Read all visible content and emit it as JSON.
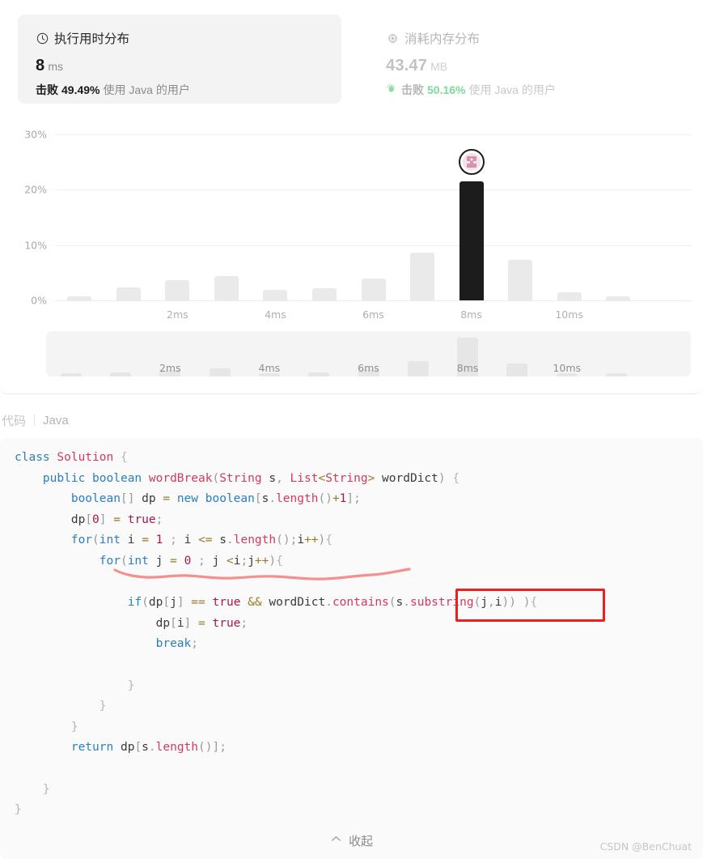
{
  "runtime_card": {
    "icon": "clock-icon",
    "title": "执行用时分布",
    "value": "8",
    "unit": "ms",
    "beat_lead": "击败",
    "beat_percent": "49.49%",
    "beat_tail": "使用 Java 的用户",
    "active": true
  },
  "memory_card": {
    "icon": "chip-icon",
    "title": "消耗内存分布",
    "value": "43.47",
    "unit": "MB",
    "hand_icon": "waving-hand-icon",
    "beat_lead": "击败",
    "beat_percent": "50.16%",
    "beat_tail": "使用 Java 的用户",
    "accent_color": "#7fd99a",
    "active": false
  },
  "chart_data": {
    "type": "bar",
    "title": "执行用时分布",
    "xlabel": "",
    "ylabel": "",
    "ylim": [
      0,
      30
    ],
    "yticks": [
      "0%",
      "10%",
      "20%",
      "30%"
    ],
    "ytick_values": [
      0,
      10,
      20,
      30
    ],
    "grid": true,
    "legend": null,
    "xticks": [
      "2ms",
      "4ms",
      "6ms",
      "8ms",
      "10ms"
    ],
    "xtick_values": [
      2,
      4,
      6,
      8,
      10
    ],
    "categories": [
      "0ms",
      "1ms",
      "2ms",
      "3ms",
      "4ms",
      "5ms",
      "6ms",
      "7ms",
      "8ms",
      "9ms",
      "10ms",
      "11ms",
      "12ms"
    ],
    "values": [
      0.7,
      2.3,
      3.6,
      4.4,
      1.9,
      2.2,
      4.0,
      8.7,
      21.5,
      7.3,
      1.5,
      0.8,
      0.0
    ],
    "highlight_index": 8,
    "highlight_label": "8ms",
    "highlight_color": "#1c1c1c",
    "bar_color": "#eaeaea",
    "marker": {
      "name": "user-avatar-marker",
      "at_category": "8ms",
      "value": 21.5
    }
  },
  "minimap": {
    "name": "chart-brush-minimap",
    "xticks": [
      "2ms",
      "4ms",
      "6ms",
      "8ms",
      "10ms"
    ],
    "values": [
      0.7,
      2.3,
      3.6,
      4.4,
      1.9,
      2.2,
      4.0,
      8.7,
      21.5,
      7.3,
      1.5,
      0.8,
      0.0
    ]
  },
  "code_header": {
    "label": "代码",
    "language": "Java"
  },
  "code": {
    "lines": [
      "class Solution {",
      "    public boolean wordBreak(String s, List<String> wordDict) {",
      "        boolean[] dp = new boolean[s.length()+1];",
      "        dp[0] = true;",
      "        for(int i = 1 ; i <= s.length();i++){",
      "            for(int j = 0 ; j <i;j++){",
      "",
      "                if(dp[j] == true && wordDict.contains(s.substring(j,i)) ){",
      "                    dp[i] = true;",
      "                    break;",
      "",
      "                }",
      "            }",
      "        }",
      "        return dp[s.length()];",
      "",
      "    }",
      "}"
    ]
  },
  "annotations": {
    "red_box_target": "(s.substring(j,i))",
    "red_box_color": "#f01f1f",
    "squiggle_color": "#f4908f",
    "squiggle_target": "for(int j = 0 ; j <i;j++){"
  },
  "collapse_button": {
    "icon": "chevron-up-icon",
    "label": "收起"
  },
  "watermark": {
    "text": "CSDN @BenChuat"
  }
}
